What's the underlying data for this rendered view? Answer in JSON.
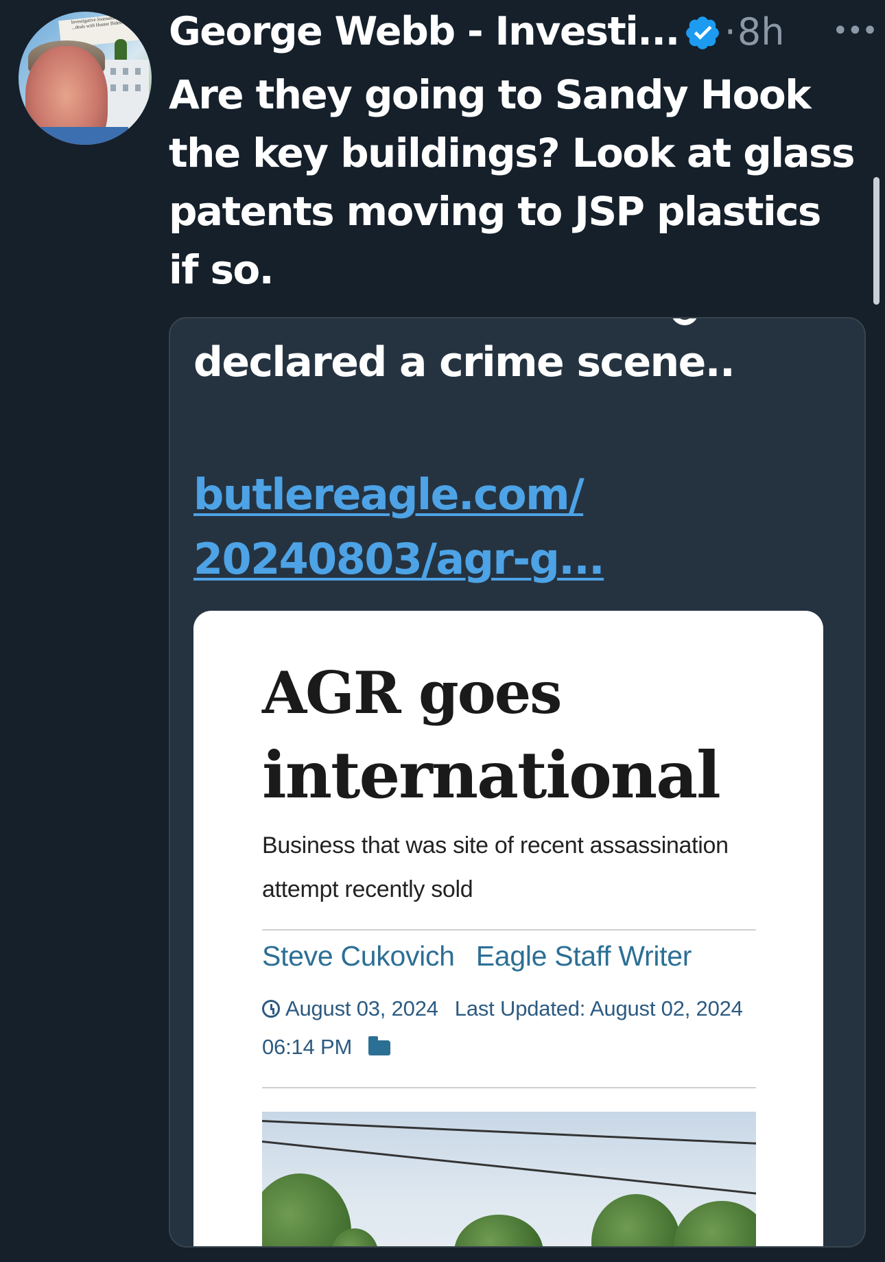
{
  "author": {
    "name": "George Webb - Investi...",
    "timestamp": "8h",
    "separator": "·"
  },
  "tweet": {
    "text": "Are they going to Sandy Hook the key buildings?  Look at glass patents moving to JSP plastics if so."
  },
  "quote": {
    "text": "declared a crime scene..",
    "link_line1": "butlereagle.com/",
    "link_line2": "20240803/agr-g..."
  },
  "article": {
    "headline_line1": "AGR goes",
    "headline_line2": "international",
    "subhead": "Business that was site of recent assassination attempt recently sold",
    "author": "Steve Cukovich",
    "author_role": "Eagle Staff Writer",
    "date": "August 03, 2024",
    "last_updated": "Last Updated: August 02, 2024 06:14 PM"
  },
  "colors": {
    "background": "#15202b",
    "link": "#4da3e6",
    "verified": "#1d9bf0",
    "muted": "#8b98a5"
  },
  "icons": [
    "verified-badge-icon",
    "more-options-icon",
    "clock-icon",
    "folder-icon"
  ]
}
